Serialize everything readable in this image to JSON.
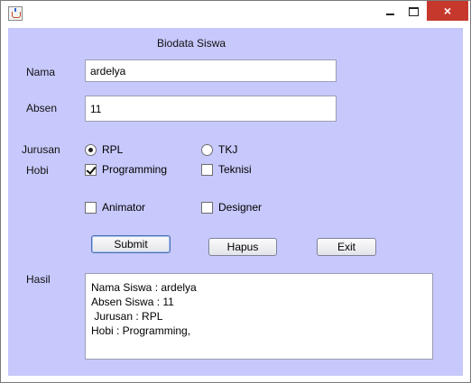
{
  "window": {
    "controls": {
      "minimize": "minimize",
      "maximize": "maximize",
      "close": "×"
    }
  },
  "form": {
    "heading": "Biodata Siswa",
    "nama": {
      "label": "Nama",
      "value": "ardelya"
    },
    "absen": {
      "label": "Absen",
      "value": "11"
    },
    "jurusan": {
      "label": "Jurusan",
      "options": [
        {
          "label": "RPL",
          "selected": true
        },
        {
          "label": "TKJ",
          "selected": false
        }
      ]
    },
    "hobi": {
      "label": "Hobi",
      "options": [
        {
          "label": "Programming",
          "checked": true
        },
        {
          "label": "Teknisi",
          "checked": false
        },
        {
          "label": "Animator",
          "checked": false
        },
        {
          "label": "Designer",
          "checked": false
        }
      ]
    },
    "buttons": {
      "submit": "Submit",
      "hapus": "Hapus",
      "exit": "Exit"
    },
    "hasil": {
      "label": "Hasil",
      "text": "Nama Siswa : ardelya\nAbsen Siswa : 11\n Jurusan : RPL\nHobi : Programming,"
    }
  },
  "colors": {
    "background": "#c7c8fb",
    "close_button": "#c7382c"
  }
}
